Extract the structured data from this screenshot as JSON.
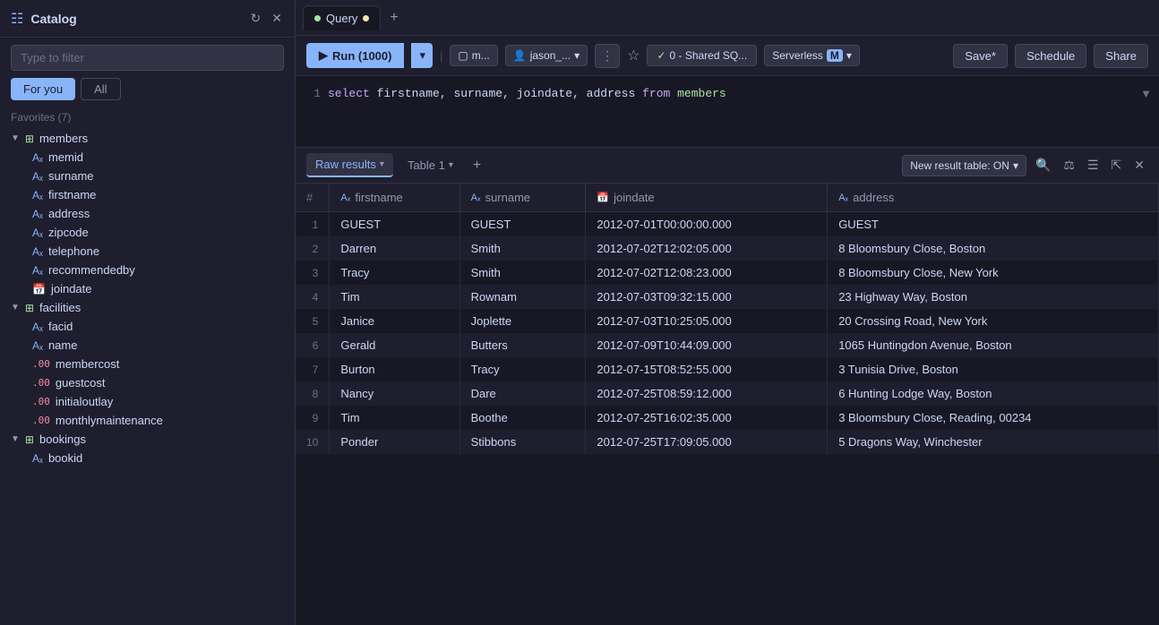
{
  "sidebar": {
    "title": "Catalog",
    "search_placeholder": "Type to filter",
    "tabs": [
      {
        "label": "For you",
        "active": true
      },
      {
        "label": "All",
        "active": false
      }
    ],
    "favorites_label": "Favorites (7)",
    "tree": {
      "groups": [
        {
          "name": "members",
          "type": "table",
          "expanded": true,
          "columns": [
            {
              "name": "memid",
              "type": "text"
            },
            {
              "name": "surname",
              "type": "text"
            },
            {
              "name": "firstname",
              "type": "text"
            },
            {
              "name": "address",
              "type": "text"
            },
            {
              "name": "zipcode",
              "type": "text"
            },
            {
              "name": "telephone",
              "type": "text"
            },
            {
              "name": "recommendedby",
              "type": "text"
            },
            {
              "name": "joindate",
              "type": "date"
            }
          ]
        },
        {
          "name": "facilities",
          "type": "table",
          "expanded": true,
          "columns": [
            {
              "name": "facid",
              "type": "text"
            },
            {
              "name": "name",
              "type": "text"
            },
            {
              "name": "membercost",
              "type": "num"
            },
            {
              "name": "guestcost",
              "type": "num"
            },
            {
              "name": "initialoutlay",
              "type": "num"
            },
            {
              "name": "monthlymaintenance",
              "type": "num"
            }
          ]
        },
        {
          "name": "bookings",
          "type": "table",
          "expanded": true,
          "columns": [
            {
              "name": "bookid",
              "type": "text"
            }
          ]
        }
      ]
    }
  },
  "editor": {
    "tab_label": "Query",
    "unsaved": true,
    "query": "select firstname, surname, joindate, address from members"
  },
  "toolbar": {
    "run_label": "Run (1000)",
    "workspace_label": "m...",
    "user_label": "jason_...",
    "connection_label": "0 - Shared SQ...",
    "serverless_label": "Serverless",
    "m_label": "M",
    "save_label": "Save*",
    "schedule_label": "Schedule",
    "share_label": "Share"
  },
  "results": {
    "tabs": [
      {
        "label": "Raw results",
        "active": true
      },
      {
        "label": "Table 1",
        "active": false
      }
    ],
    "new_result_label": "New result table: ON",
    "columns": [
      {
        "name": "firstname",
        "type": "text"
      },
      {
        "name": "surname",
        "type": "text"
      },
      {
        "name": "joindate",
        "type": "date"
      },
      {
        "name": "address",
        "type": "text"
      }
    ],
    "rows": [
      {
        "num": 1,
        "firstname": "GUEST",
        "surname": "GUEST",
        "joindate": "2012-07-01T00:00:00.000",
        "address": "GUEST"
      },
      {
        "num": 2,
        "firstname": "Darren",
        "surname": "Smith",
        "joindate": "2012-07-02T12:02:05.000",
        "address": "8 Bloomsbury Close, Boston"
      },
      {
        "num": 3,
        "firstname": "Tracy",
        "surname": "Smith",
        "joindate": "2012-07-02T12:08:23.000",
        "address": "8 Bloomsbury Close, New York"
      },
      {
        "num": 4,
        "firstname": "Tim",
        "surname": "Rownam",
        "joindate": "2012-07-03T09:32:15.000",
        "address": "23 Highway Way, Boston"
      },
      {
        "num": 5,
        "firstname": "Janice",
        "surname": "Joplette",
        "joindate": "2012-07-03T10:25:05.000",
        "address": "20 Crossing Road, New York"
      },
      {
        "num": 6,
        "firstname": "Gerald",
        "surname": "Butters",
        "joindate": "2012-07-09T10:44:09.000",
        "address": "1065 Huntingdon Avenue, Boston"
      },
      {
        "num": 7,
        "firstname": "Burton",
        "surname": "Tracy",
        "joindate": "2012-07-15T08:52:55.000",
        "address": "3 Tunisia Drive, Boston"
      },
      {
        "num": 8,
        "firstname": "Nancy",
        "surname": "Dare",
        "joindate": "2012-07-25T08:59:12.000",
        "address": "6 Hunting Lodge Way, Boston"
      },
      {
        "num": 9,
        "firstname": "Tim",
        "surname": "Boothe",
        "joindate": "2012-07-25T16:02:35.000",
        "address": "3 Bloomsbury Close, Reading, 00234"
      },
      {
        "num": 10,
        "firstname": "Ponder",
        "surname": "Stibbons",
        "joindate": "2012-07-25T17:09:05.000",
        "address": "5 Dragons Way, Winchester"
      }
    ]
  }
}
